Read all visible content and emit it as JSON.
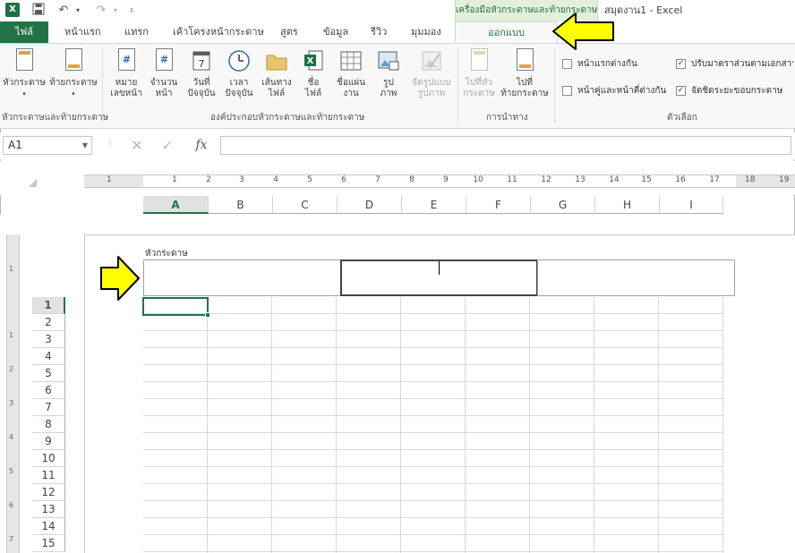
{
  "title_bar": {
    "logo_text": "X",
    "context_tab_header": "เครื่องมือหัวกระดาษและท้ายกระดาษ",
    "window_title": "สมุดงาน1 - Excel",
    "qat": {
      "save_icon": "save-icon",
      "undo_icon": "undo-icon",
      "redo_icon": "redo-icon",
      "customize_icon": "qat-customize-icon"
    }
  },
  "tabs": {
    "file": "ไฟล์",
    "items": [
      "หน้าแรก",
      "แทรก",
      "เค้าโครงหน้ากระดาษ",
      "สูตร",
      "ข้อมูล",
      "รีวิว",
      "มุมมอง"
    ],
    "active": "ออกแบบ"
  },
  "ribbon": {
    "groups": {
      "header_footer": "หัวกระดาษและท้ายกระดาษ",
      "elements": "องค์ประกอบหัวกระดาษและท้ายกระดาษ",
      "navigation": "การนำทาง",
      "options": "ตัวเลือก"
    },
    "buttons": {
      "header": "หัวกระดาษ",
      "footer": "ท้ายกระดาษ",
      "page_number_1": "หมาย",
      "page_number_2": "เลขหน้า",
      "page_count_1": "จำนวน",
      "page_count_2": "หน้า",
      "current_date_1": "วันที่",
      "current_date_2": "ปัจจุบัน",
      "current_time_1": "เวลา",
      "current_time_2": "ปัจจุบัน",
      "file_path_1": "เส้นทาง",
      "file_path_2": "ไฟล์",
      "file_name_1": "ชื่อ",
      "file_name_2": "ไฟล์",
      "sheet_name_1": "ชื่อแผ่น",
      "sheet_name_2": "งาน",
      "picture_1": "รูป",
      "picture_2": "ภาพ",
      "format_picture_1": "จัดรูปแบบ",
      "format_picture_2": "รูปภาพ",
      "goto_header_1": "ไปที่หัว",
      "goto_header_2": "กระดาษ",
      "goto_footer_1": "ไปที่",
      "goto_footer_2": "ท้ายกระดาษ"
    },
    "options": {
      "different_first_page": "หน้าแรกต่างกัน",
      "different_odd_even": "หน้าคู่และหน้าคี่ต่างกัน",
      "scale_with_document": "ปรับมาตราส่วนตามเอกสาร",
      "align_with_margins": "จัดชิดระยะขอบกระดาษ",
      "different_first_page_checked": false,
      "different_odd_even_checked": false,
      "scale_with_document_checked": true,
      "align_with_margins_checked": true
    }
  },
  "formula_bar": {
    "name_box": "A1",
    "cancel_icon": "cancel-icon",
    "enter_icon": "enter-icon",
    "fx_label": "fx",
    "value": ""
  },
  "ruler": {
    "numbers": [
      "1",
      "1",
      "2",
      "3",
      "4",
      "5",
      "6",
      "7",
      "8",
      "9",
      "10",
      "11",
      "12",
      "13",
      "14",
      "15",
      "16",
      "17",
      "18",
      "19"
    ]
  },
  "vertical_ruler": {
    "numbers": [
      "1",
      "1",
      "2",
      "3",
      "4",
      "5",
      "6",
      "7"
    ]
  },
  "sheet": {
    "columns": [
      "A",
      "B",
      "C",
      "D",
      "E",
      "F",
      "G",
      "H",
      "I"
    ],
    "rows": [
      "1",
      "2",
      "3",
      "4",
      "5",
      "6",
      "7",
      "8",
      "9",
      "10",
      "11",
      "12",
      "13",
      "14",
      "15"
    ],
    "active_cell": "A1",
    "header_label": "หัวกระดาษ"
  },
  "colors": {
    "excel_green": "#217346",
    "arrow_fill": "#ffff00",
    "context_tab_bg": "#e2efd9"
  }
}
